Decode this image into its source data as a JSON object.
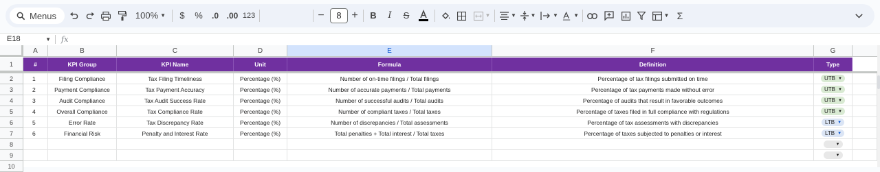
{
  "toolbar": {
    "menus_label": "Menus",
    "zoom": "100%",
    "currency": "$",
    "percent": "%",
    "decrease_decimal": ".0",
    "increase_decimal": ".00",
    "number_format": "123",
    "font_size": "8"
  },
  "formula_bar": {
    "cell_ref": "E18",
    "fx": "fx",
    "formula": ""
  },
  "columns": [
    "A",
    "B",
    "C",
    "D",
    "E",
    "F",
    "G"
  ],
  "row_numbers": [
    "1",
    "2",
    "3",
    "4",
    "5",
    "6",
    "7",
    "8",
    "9",
    "10"
  ],
  "headers": [
    "#",
    "KPI Group",
    "KPI Name",
    "Unit",
    "Formula",
    "Definition",
    "Type"
  ],
  "rows": [
    {
      "num": "1",
      "group": "Filing Compliance",
      "name": "Tax Filing Timeliness",
      "unit": "Percentage (%)",
      "formula": "Number of on-time filings / Total filings",
      "definition": "Percentage of tax filings submitted on time",
      "type": "UTB"
    },
    {
      "num": "2",
      "group": "Payment Compliance",
      "name": "Tax Payment Accuracy",
      "unit": "Percentage (%)",
      "formula": "Number of accurate payments / Total payments",
      "definition": "Percentage of tax payments made without error",
      "type": "UTB"
    },
    {
      "num": "3",
      "group": "Audit Compliance",
      "name": "Tax Audit Success Rate",
      "unit": "Percentage (%)",
      "formula": "Number of successful audits / Total audits",
      "definition": "Percentage of audits that result in favorable outcomes",
      "type": "UTB"
    },
    {
      "num": "4",
      "group": "Overall Compliance",
      "name": "Tax Compliance Rate",
      "unit": "Percentage (%)",
      "formula": "Number of compliant taxes / Total taxes",
      "definition": "Percentage of taxes filed in full compliance with regulations",
      "type": "UTB"
    },
    {
      "num": "5",
      "group": "Error Rate",
      "name": "Tax Discrepancy Rate",
      "unit": "Percentage (%)",
      "formula": "Number of discrepancies / Total assessments",
      "definition": "Percentage of tax assessments with discrepancies",
      "type": "LTB"
    },
    {
      "num": "6",
      "group": "Financial Risk",
      "name": "Penalty and Interest Rate",
      "unit": "Percentage (%)",
      "formula": "Total penalties + Total interest / Total taxes",
      "definition": "Percentage of taxes subjected to penalties or interest",
      "type": "LTB"
    }
  ],
  "colors": {
    "header_bg": "#7030a0",
    "utb_chip": "#d9ead3",
    "ltb_chip": "#dbe5f5",
    "selected_col": "#d3e3fd"
  }
}
